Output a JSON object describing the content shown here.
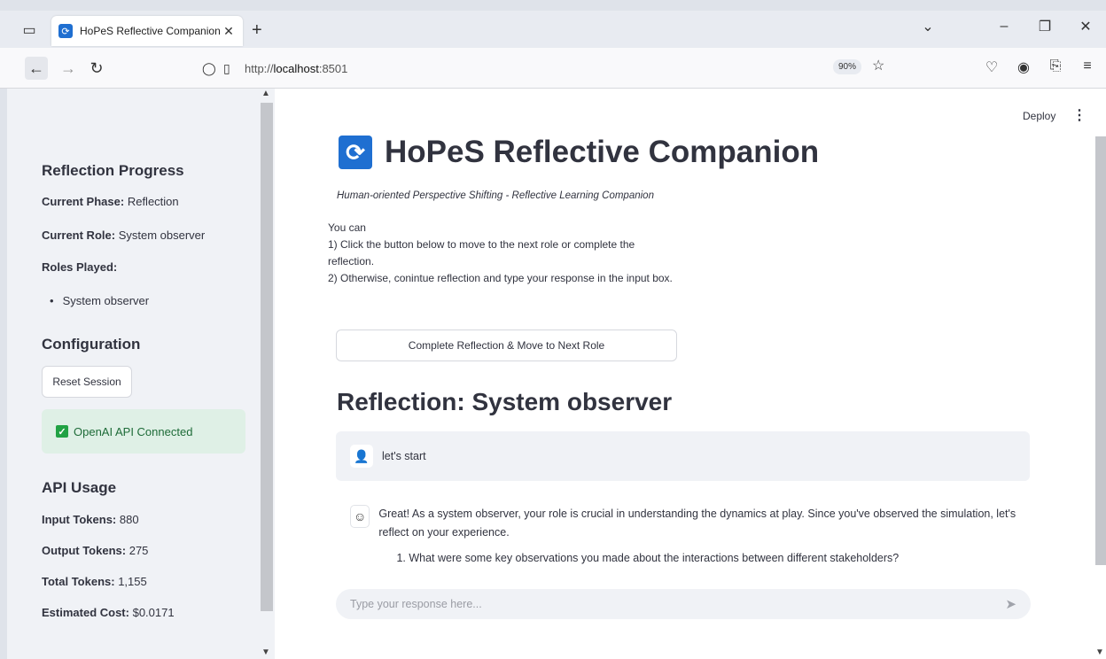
{
  "browser": {
    "tab_title": "HoPeS Reflective Companion",
    "url_prefix": "http://",
    "url_host": "localhost",
    "url_port": ":8501",
    "zoom": "90%"
  },
  "header": {
    "deploy_label": "Deploy"
  },
  "sidebar": {
    "progress_heading": "Reflection Progress",
    "current_phase_key": "Current Phase:",
    "current_phase_value": "Reflection",
    "current_role_key": "Current Role:",
    "current_role_value": "System observer",
    "roles_played_key": "Roles Played:",
    "roles_played": [
      "System observer"
    ],
    "config_heading": "Configuration",
    "reset_label": "Reset Session",
    "api_status": "OpenAI API Connected",
    "usage_heading": "API Usage",
    "input_tokens_key": "Input Tokens:",
    "input_tokens_value": "880",
    "output_tokens_key": "Output Tokens:",
    "output_tokens_value": "275",
    "total_tokens_key": "Total Tokens:",
    "total_tokens_value": "1,155",
    "cost_key": "Estimated Cost:",
    "cost_value": "$0.0171"
  },
  "main": {
    "title": "HoPeS Reflective Companion",
    "subtitle": "Human-oriented Perspective Shifting - Reflective Learning Companion",
    "instructions": [
      "You can",
      " 1) Click the button below to move to the next role or complete the reflection.",
      " 2) Otherwise, conintue reflection and type your response in the input box."
    ],
    "next_button": "Complete Reflection & Move to Next Role",
    "section_heading": "Reflection: System observer",
    "user_message": "let's start",
    "assistant_message": "Great! As a system observer, your role is crucial in understanding the dynamics at play. Since you've observed the simulation, let's reflect on your experience.",
    "assistant_list": [
      "What were some key observations you made about the interactions between different stakeholders?"
    ],
    "input_placeholder": "Type your response here..."
  }
}
